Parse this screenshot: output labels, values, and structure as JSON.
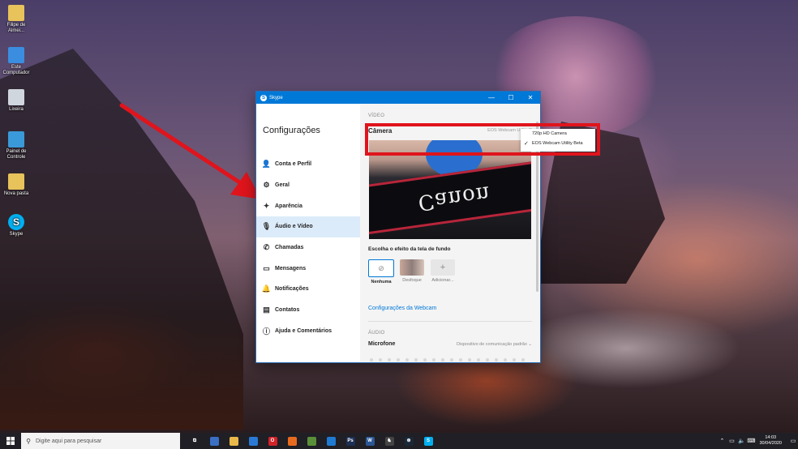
{
  "desktop": {
    "icons": [
      {
        "label": "Filipe de Almei...",
        "icon": "folder-user-icon"
      },
      {
        "label": "Este Computador",
        "icon": "computer-icon"
      },
      {
        "label": "Lixeira",
        "icon": "recycle-bin-icon"
      },
      {
        "label": "Painel de Controle",
        "icon": "control-panel-icon"
      },
      {
        "label": "Nova pasta",
        "icon": "folder-icon"
      },
      {
        "label": "Skype",
        "icon": "skype-icon"
      }
    ]
  },
  "window": {
    "title": "Skype",
    "controls": {
      "minimize": "—",
      "maximize": "☐",
      "close": "✕"
    }
  },
  "sidebar": {
    "title": "Configurações",
    "items": [
      {
        "label": "Conta e Perfil",
        "icon": "user-icon",
        "glyph": "👤"
      },
      {
        "label": "Geral",
        "icon": "gear-icon",
        "glyph": "⚙"
      },
      {
        "label": "Aparência",
        "icon": "magic-wand-icon",
        "glyph": "✦"
      },
      {
        "label": "Áudio e Vídeo",
        "icon": "microphone-icon",
        "glyph": "🎙"
      },
      {
        "label": "Chamadas",
        "icon": "phone-icon",
        "glyph": "✆"
      },
      {
        "label": "Mensagens",
        "icon": "message-icon",
        "glyph": "▭"
      },
      {
        "label": "Notificações",
        "icon": "bell-icon",
        "glyph": "🔔"
      },
      {
        "label": "Contatos",
        "icon": "contacts-icon",
        "glyph": "▤"
      },
      {
        "label": "Ajuda e Comentários",
        "icon": "info-icon",
        "glyph": "ⓘ"
      }
    ],
    "active_index": 3
  },
  "video": {
    "section_label": "VÍDEO",
    "camera_label": "Câmera",
    "camera_value": "EOS Webcam Utility B",
    "background_title": "Escolha o efeito da tela de fundo",
    "effects": [
      {
        "label": "Nenhuma",
        "glyph": "⊘",
        "selected": true
      },
      {
        "label": "Desfoque",
        "glyph": "",
        "selected": false
      },
      {
        "label": "Adicionar...",
        "glyph": "+",
        "selected": false
      }
    ],
    "webcam_settings_link": "Configurações da Webcam",
    "preview_text": "Canon"
  },
  "audio": {
    "section_label": "ÁUDIO",
    "mic_label": "Microfone",
    "mic_value": "Dispositivo de comunicação padrão ⌄"
  },
  "dropdown": {
    "options": [
      {
        "label": "720p HD Camera",
        "checked": false
      },
      {
        "label": "EOS Webcam Utility Beta",
        "checked": true
      }
    ]
  },
  "taskbar": {
    "search_placeholder": "Digite aqui para pesquisar",
    "apps": [
      {
        "icon": "task-view-icon",
        "color": "#1f1f25",
        "glyph": "⧉"
      },
      {
        "icon": "photos-icon",
        "color": "#3a6fc4",
        "glyph": ""
      },
      {
        "icon": "file-explorer-icon",
        "color": "#e8b84a",
        "glyph": ""
      },
      {
        "icon": "mail-icon",
        "color": "#2a7ad5",
        "glyph": ""
      },
      {
        "icon": "opera-icon",
        "color": "#d2232a",
        "glyph": "O"
      },
      {
        "icon": "firefox-icon",
        "color": "#e86a1f",
        "glyph": ""
      },
      {
        "icon": "minecraft-icon",
        "color": "#5a8f3a",
        "glyph": ""
      },
      {
        "icon": "vscode-icon",
        "color": "#1f7ad2",
        "glyph": ""
      },
      {
        "icon": "photoshop-icon",
        "color": "#1d2f55",
        "glyph": "Ps"
      },
      {
        "icon": "word-icon",
        "color": "#2b5797",
        "glyph": "W"
      },
      {
        "icon": "game-icon",
        "color": "#444444",
        "glyph": "♞"
      },
      {
        "icon": "steam-icon",
        "color": "#1b2838",
        "glyph": "⊛"
      },
      {
        "icon": "skype-taskbar-icon",
        "color": "#00aff0",
        "glyph": "S"
      }
    ],
    "time": "14:03",
    "date": "30/04/2020"
  },
  "colors": {
    "accent": "#0078d7",
    "highlight": "#e0141c",
    "arrow": "#e0141c"
  }
}
